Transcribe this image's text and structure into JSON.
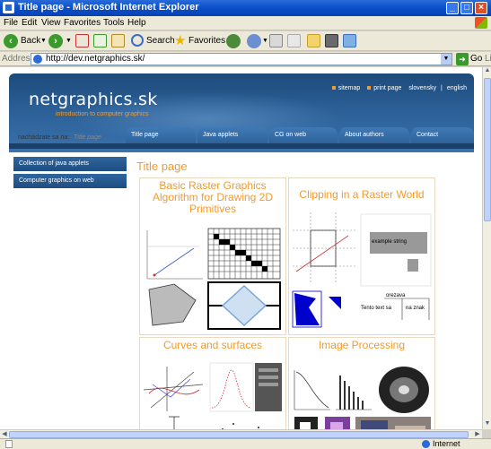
{
  "window": {
    "title": "Title page - Microsoft Internet Explorer",
    "buttons": {
      "minimize": "_",
      "maximize": "□",
      "close": "×"
    }
  },
  "menu": [
    "File",
    "Edit",
    "View",
    "Favorites",
    "Tools",
    "Help"
  ],
  "toolbar": {
    "back_label": "Back",
    "search_label": "Search",
    "favorites_label": "Favorites"
  },
  "addressbar": {
    "label": "Address",
    "url": "http://dev.netgraphics.sk/",
    "go_label": "Go",
    "links_label": "Links"
  },
  "status": {
    "zone": "Internet"
  },
  "site": {
    "logo": "netgraphics.sk",
    "tagline": "introduction to computer graphics",
    "top_links": [
      "sitemap",
      "print page",
      "slovensky",
      "english"
    ],
    "nav": [
      "Title page",
      "Java applets",
      "CG on web",
      "About authors",
      "Contact"
    ],
    "breadcrumb_label": "nachádzate sa na:",
    "breadcrumb_current": "Title page",
    "sidebar": [
      "Collection of java applets",
      "Computer graphics on web"
    ],
    "page_title": "Title page",
    "cards": [
      {
        "title": "Basic Raster Graphics Algorithm for Drawing 2D Primitives"
      },
      {
        "title": "Clipping in a Raster World",
        "clip_text_1": "example string",
        "clip_text_2": "Tento text sa",
        "clip_text_3": "na znak",
        "clip_text_4": "orezava"
      },
      {
        "title": "Curves and surfaces"
      },
      {
        "title": "Image Processing"
      }
    ]
  },
  "colors": {
    "accent_orange": "#f39a2a",
    "header_blue": "#1d4a7a",
    "nav_blue": "#2f659e"
  }
}
